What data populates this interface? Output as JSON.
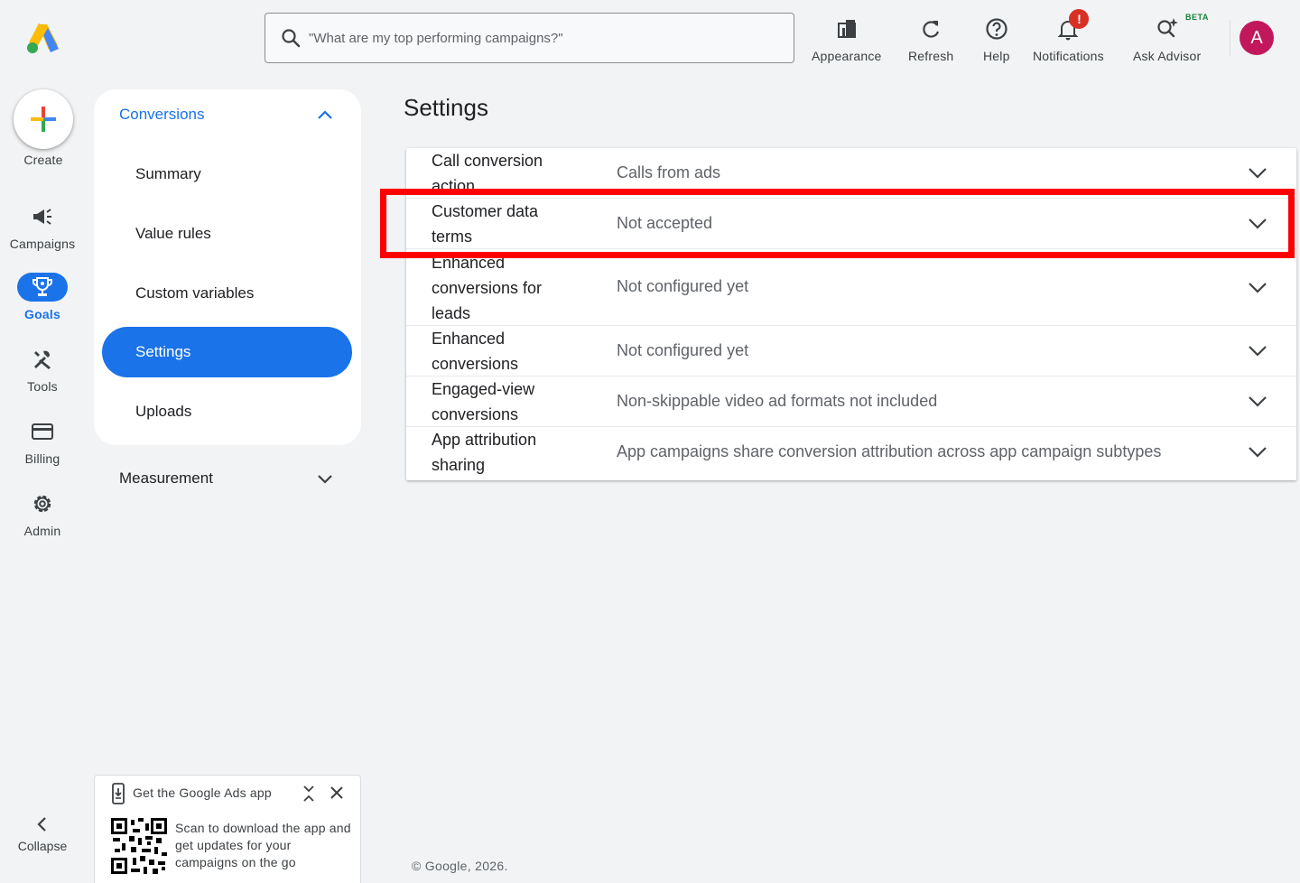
{
  "header": {
    "search_placeholder": "\"What are my top performing campaigns?\"",
    "buttons": [
      {
        "label": "Appearance",
        "icon": "appearance-icon"
      },
      {
        "label": "Refresh",
        "icon": "refresh-icon"
      },
      {
        "label": "Help",
        "icon": "help-icon"
      },
      {
        "label": "Notifications",
        "icon": "bell-icon"
      },
      {
        "label": "Ask Advisor",
        "icon": "ask-advisor-icon"
      }
    ],
    "notification_badge": "!",
    "beta_label": "BETA",
    "avatar_initial": "A"
  },
  "rail": {
    "create_label": "Create",
    "items": [
      {
        "label": "Campaigns",
        "icon": "megaphone-icon"
      },
      {
        "label": "Goals",
        "icon": "trophy-icon",
        "active": true
      },
      {
        "label": "Tools",
        "icon": "tools-icon"
      },
      {
        "label": "Billing",
        "icon": "credit-card-icon"
      },
      {
        "label": "Admin",
        "icon": "gear-icon"
      }
    ],
    "collapse_label": "Collapse"
  },
  "subnav": {
    "section_label": "Conversions",
    "items": [
      "Summary",
      "Value rules",
      "Custom variables",
      "Settings",
      "Uploads"
    ],
    "selected": "Settings",
    "measurement_label": "Measurement"
  },
  "main": {
    "title": "Settings",
    "rows": [
      {
        "name": "Call conversion action",
        "value": "Calls from ads"
      },
      {
        "name": "Customer data terms",
        "value": "Not accepted"
      },
      {
        "name": "Enhanced conversions for leads",
        "value": "Not configured yet"
      },
      {
        "name": "Enhanced conversions",
        "value": "Not configured yet"
      },
      {
        "name": "Engaged-view conversions",
        "value": "Non-skippable video ad formats not included"
      },
      {
        "name": "App attribution sharing",
        "value": "App campaigns share conversion attribution across app campaign subtypes"
      }
    ],
    "highlight_color": "#ff0000"
  },
  "promo": {
    "title": "Get the Google Ads app",
    "description": "Scan to download the app and get updates for your campaigns on the go"
  },
  "footer": "© Google, 2026.",
  "colors": {
    "accent": "#1a73e8",
    "avatar": "#c2185b",
    "badge": "#d93025"
  }
}
